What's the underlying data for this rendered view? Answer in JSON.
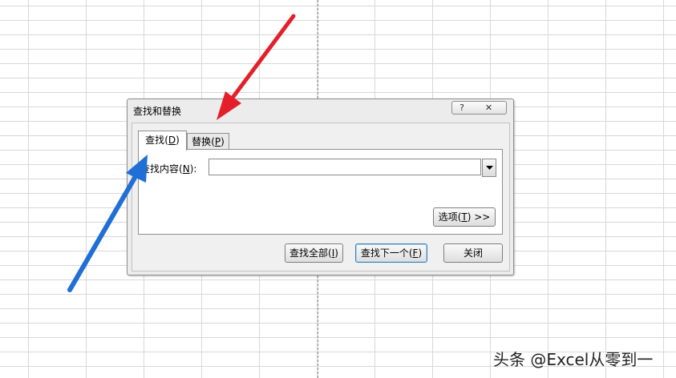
{
  "dialog": {
    "title": "查找和替换",
    "help_label": "?",
    "close_x_label": "✕",
    "tabs": [
      {
        "label": "查找",
        "key": "D"
      },
      {
        "label": "替换",
        "key": "P"
      }
    ],
    "find_label": "查找内容",
    "find_key": "N",
    "find_value": "",
    "options_label": "选项",
    "options_key": "T",
    "options_suffix": ">>",
    "buttons": {
      "find_all": {
        "label": "查找全部",
        "key": "I"
      },
      "find_next": {
        "label": "查找下一个",
        "key": "F"
      },
      "close": "关闭"
    }
  },
  "annotations": {
    "red_arrow_color": "#e3202a",
    "blue_arrow_color": "#1f6fd6"
  },
  "watermark": "头条 @Excel从零到一"
}
